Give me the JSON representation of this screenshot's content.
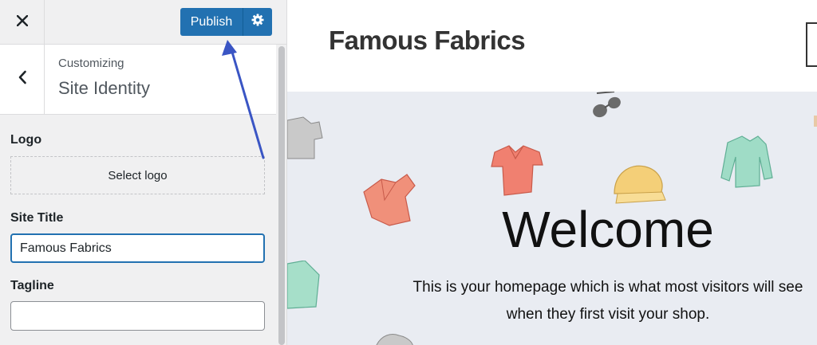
{
  "customizer": {
    "publish_label": "Publish",
    "breadcrumb": "Customizing",
    "section_title": "Site Identity",
    "logo": {
      "label": "Logo",
      "button_label": "Select logo"
    },
    "site_title": {
      "label": "Site Title",
      "value": "Famous Fabrics"
    },
    "tagline": {
      "label": "Tagline",
      "value": ""
    }
  },
  "preview": {
    "site_title": "Famous Fabrics",
    "hero_heading": "Welcome",
    "hero_text": "This is your homepage which is what most visitors will see when they first visit your shop."
  },
  "icons": {
    "close": "close-icon",
    "gear": "gear-icon",
    "back": "chevron-left-icon"
  },
  "colors": {
    "accent": "#2271b1",
    "sidebar_bg": "#f0f0f1",
    "hero_bg": "#e9ecf2",
    "annotation_arrow": "#3a55c4"
  }
}
